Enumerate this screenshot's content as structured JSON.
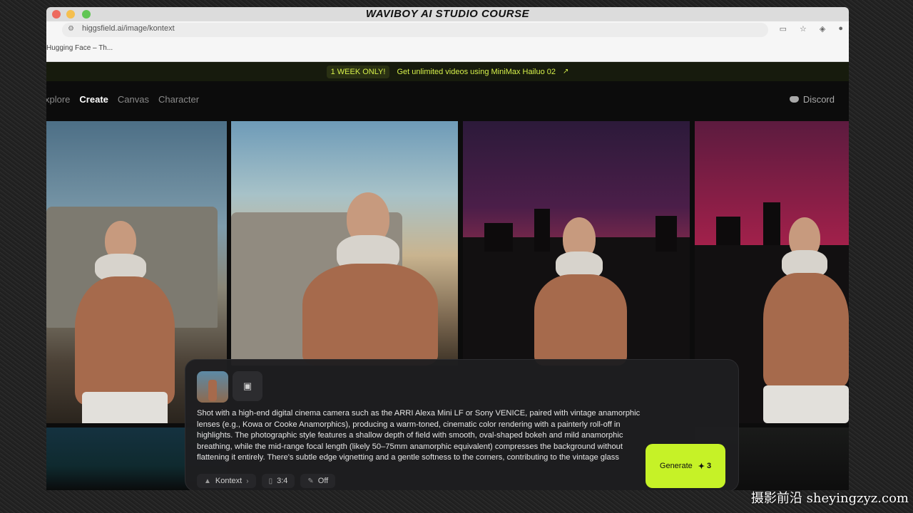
{
  "window": {
    "title": "WAVIBOY AI STUDIO COURSE"
  },
  "browser": {
    "url": "higgsfield.ai/image/kontext",
    "bookmark": "Hugging Face – Th..."
  },
  "promo": {
    "badge": "1 WEEK ONLY!",
    "text": "Get unlimited videos using MiniMax Hailuo 02",
    "arrow": "↗"
  },
  "nav": {
    "items": [
      {
        "label": "xplore",
        "active": false
      },
      {
        "label": "Create",
        "active": true
      },
      {
        "label": "Canvas",
        "active": false
      },
      {
        "label": "Character",
        "active": false
      }
    ],
    "discord": "Discord"
  },
  "composer": {
    "prompt": "Shot with a high-end digital cinema camera such as the ARRI Alexa Mini LF or Sony VENICE, paired with vintage anamorphic lenses (e.g., Kowa or Cooke Anamorphics), producing a warm-toned, cinematic color rendering with a painterly roll-off in highlights. The photographic style features a shallow depth of field with smooth, oval-shaped bokeh and mild anamorphic breathing, while the mid-range focal length (likely 50–75mm anamorphic equivalent) compresses the background without flattening it entirely. There's subtle edge vignetting and a gentle softness to the corners, contributing to the vintage glass aesthetic. The color palette is dominantly warm with golden-hour ambers",
    "generate_label": "Generate",
    "generate_cost": "3",
    "chips": [
      {
        "icon": "model-icon",
        "label": "Kontext",
        "suffix": "›"
      },
      {
        "icon": "aspect-icon",
        "label": "3:4",
        "suffix": ""
      },
      {
        "icon": "enhance-icon",
        "label": "Off",
        "suffix": ""
      }
    ]
  },
  "watermark": "摄影前沿 sheyingzyz.com",
  "colors": {
    "accent": "#c6f227",
    "promo_text": "#d6f04a"
  }
}
